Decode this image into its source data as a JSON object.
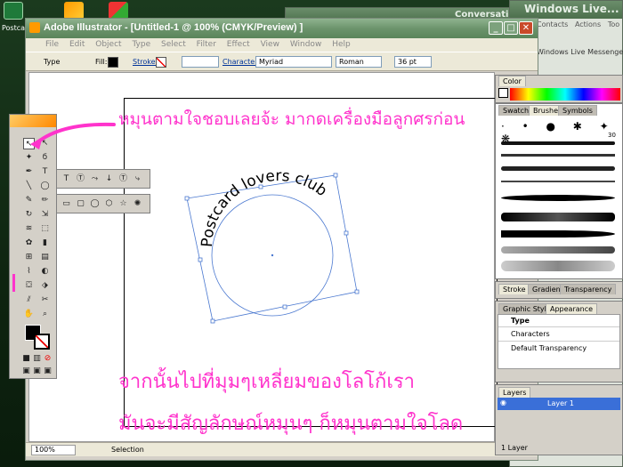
{
  "desktop": {
    "icon_label": "Postcar",
    "bg_window_title": "Windows Live...",
    "bg_window_tabs": [
      "Contacts",
      "Actions",
      "Too"
    ],
    "messenger_label": "Windows Live Messenger",
    "bg_window2_title": "Conversation"
  },
  "app": {
    "title": "Adobe Illustrator - [Untitled-1 @ 100% (CMYK/Preview) ]",
    "menu": [
      "File",
      "Edit",
      "Object",
      "Type",
      "Select",
      "Filter",
      "Effect",
      "View",
      "Window",
      "Help"
    ]
  },
  "control_bar": {
    "type_label": "Type",
    "fill_label": "Fill:",
    "stroke_label": "Stroke:",
    "character_label": "Character:",
    "font_family": "Myriad",
    "font_style": "Roman",
    "font_size": "36 pt"
  },
  "canvas": {
    "curved_text": "Postcard lovers club",
    "annotation_top": "หมุนตามใจชอบเลยจ้ะ  มากดเครื่องมือลูกศรก่อน",
    "annotation_bottom_1": "จากนั้นไปที่มุมๆเหลี่ยมของโลโก้เรา",
    "annotation_bottom_2": "มันจะมีสัญลักษณ์หมุนๆ  ก็หมุนตามใจโลด"
  },
  "status": {
    "zoom": "100%",
    "tool": "Selection"
  },
  "panels": {
    "color_tab": "Color",
    "swatch_tabs": [
      "Swatches",
      "Brushes",
      "Symbols"
    ],
    "brush_size": "30",
    "stroke_tabs": [
      "Stroke",
      "Gradient",
      "Transparency"
    ],
    "appearance_tabs": [
      "Graphic Styles",
      "Appearance"
    ],
    "appearance_items": [
      "Type",
      "Characters",
      "Default Transparency"
    ],
    "layers_tab": "Layers",
    "layer_name": "Layer 1",
    "layer_count": "1 Layer"
  },
  "colors": {
    "annotation": "#ff33cc",
    "selection": "#4a78d0",
    "title_green": "#6c946c"
  }
}
